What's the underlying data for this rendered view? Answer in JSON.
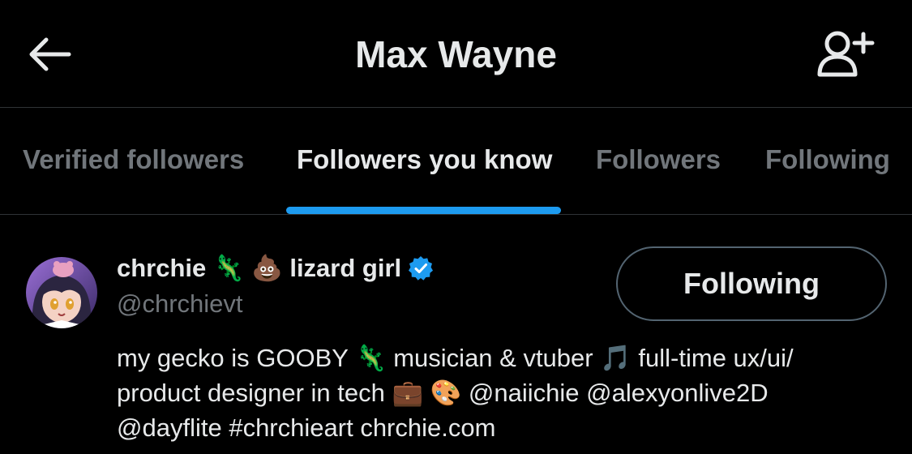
{
  "header": {
    "title": "Max Wayne",
    "back_icon": "arrow-left-icon",
    "follow_icon": "add-person-icon"
  },
  "tabs": [
    {
      "label": "Verified followers",
      "active": false
    },
    {
      "label": "Followers you know",
      "active": true
    },
    {
      "label": "Followers",
      "active": false
    },
    {
      "label": "Following",
      "active": false
    }
  ],
  "user": {
    "name_part1": "chrchie 🦎 💩",
    "name_part2": "lizard girl",
    "handle": "@chrchievt",
    "verified": true,
    "follow_button_label": "Following",
    "bio": {
      "line1_text": "my gecko is GOOBY 🦎 musician & vtuber 🎵 full-time ux/ui/",
      "line2_text": "product designer in tech 💼 🎨 ",
      "line2_mention1": "@naiichie",
      "line2_mention2": "@alexyonlive2D",
      "line3_mention": "@dayflite",
      "line3_hashtag": "#chrchieart",
      "line3_link": "chrchie.com"
    }
  },
  "colors": {
    "background": "#000000",
    "text_primary": "#e7e9ea",
    "text_secondary": "#71767b",
    "accent": "#1d9bf0",
    "divider": "#2f3336"
  }
}
